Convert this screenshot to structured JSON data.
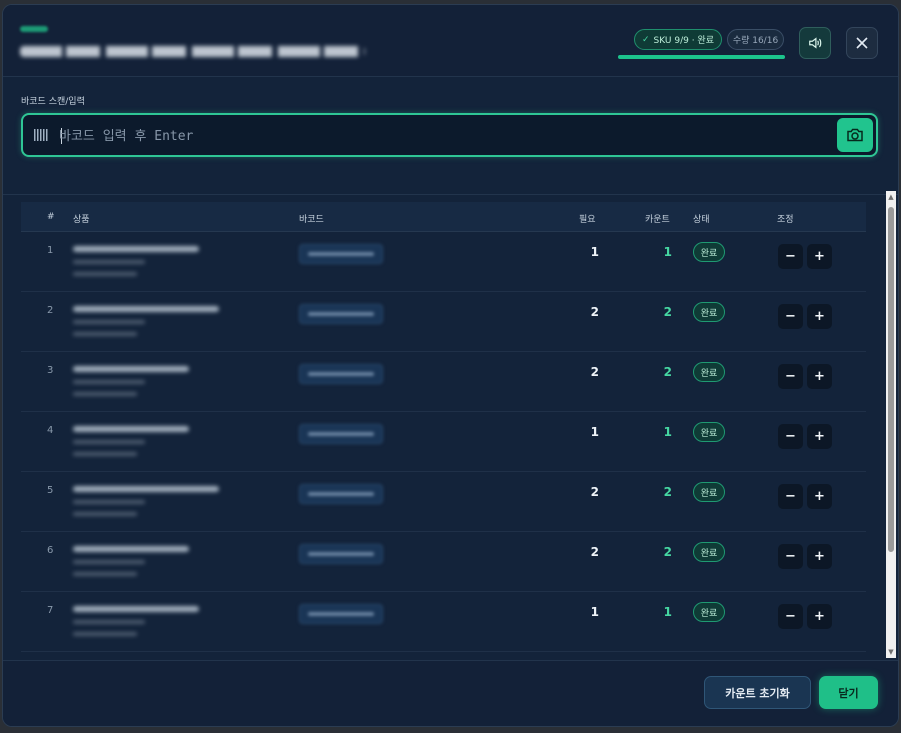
{
  "header": {
    "sku_status": "SKU  9/9 · 완료",
    "qty_status": "수량  16/16",
    "progress": 1.0,
    "accent_color": "#1cc38c"
  },
  "barcode": {
    "label": "바코드 스캔/입력",
    "placeholder": "바코드 입력 후 Enter",
    "value": ""
  },
  "table": {
    "columns": [
      "#",
      "상품",
      "바코드",
      "필요",
      "카운트",
      "상태",
      "조정"
    ],
    "rows": [
      {
        "num": "1",
        "need": "1",
        "count": "1",
        "status": "완료"
      },
      {
        "num": "2",
        "need": "2",
        "count": "2",
        "status": "완료"
      },
      {
        "num": "3",
        "need": "2",
        "count": "2",
        "status": "완료"
      },
      {
        "num": "4",
        "need": "1",
        "count": "1",
        "status": "완료"
      },
      {
        "num": "5",
        "need": "2",
        "count": "2",
        "status": "완료"
      },
      {
        "num": "6",
        "need": "2",
        "count": "2",
        "status": "완료"
      },
      {
        "num": "7",
        "need": "1",
        "count": "1",
        "status": "완료"
      }
    ],
    "minus_label": "−",
    "plus_label": "+"
  },
  "footer": {
    "reset_label": "카운트 초기화",
    "close_label": "닫기"
  },
  "icons": {
    "close": "close-icon",
    "sound": "speaker-icon",
    "camera": "camera-icon",
    "barcode": "barcode-icon",
    "check": "check-icon"
  }
}
